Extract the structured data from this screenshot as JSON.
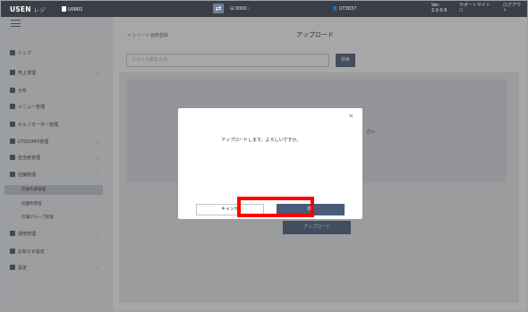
{
  "topbar": {
    "brand": "USEN",
    "brand_sub": "レジ",
    "store_code": "U0001",
    "pos_label": "0000 :",
    "user_label": "UT3837",
    "version_label": "Ver.",
    "version_number": "2.0.0.6",
    "support_link": "サポートサイト",
    "logout_link": "ログアウ",
    "logout_link_2": "ト"
  },
  "sidebar": {
    "items": [
      {
        "label": "トップ"
      },
      {
        "label": "売上管理"
      },
      {
        "label": "分析"
      },
      {
        "label": "メニュー管理"
      },
      {
        "label": "セルフオーダー管理"
      },
      {
        "label": "UTO/UMO管理"
      },
      {
        "label": "担当者管理"
      },
      {
        "label": "店舗管理"
      }
    ],
    "sub_items": [
      {
        "label": "店舗作業管理"
      },
      {
        "label": "店舗別管理"
      },
      {
        "label": "店舗グループ管理"
      }
    ],
    "items_after": [
      {
        "label": "運用管理"
      },
      {
        "label": "お知らせ設定"
      },
      {
        "label": "設定"
      }
    ]
  },
  "main": {
    "breadcrumb": "< レシート画像登録",
    "title": "アップロード",
    "search_placeholder": "ファイル名を入力",
    "search_button": "検索",
    "upload_area_peek": "さい",
    "upload_button": "アップロード"
  },
  "dialog": {
    "message": "アップロードします。よろしいですか。",
    "cancel_label": "キャンセ",
    "ok_label": "OK",
    "close_glyph": "×"
  },
  "colors": {
    "topbar": "#3a3f47",
    "primary_button": "#4a5c7a",
    "highlight": "#ff0000"
  }
}
